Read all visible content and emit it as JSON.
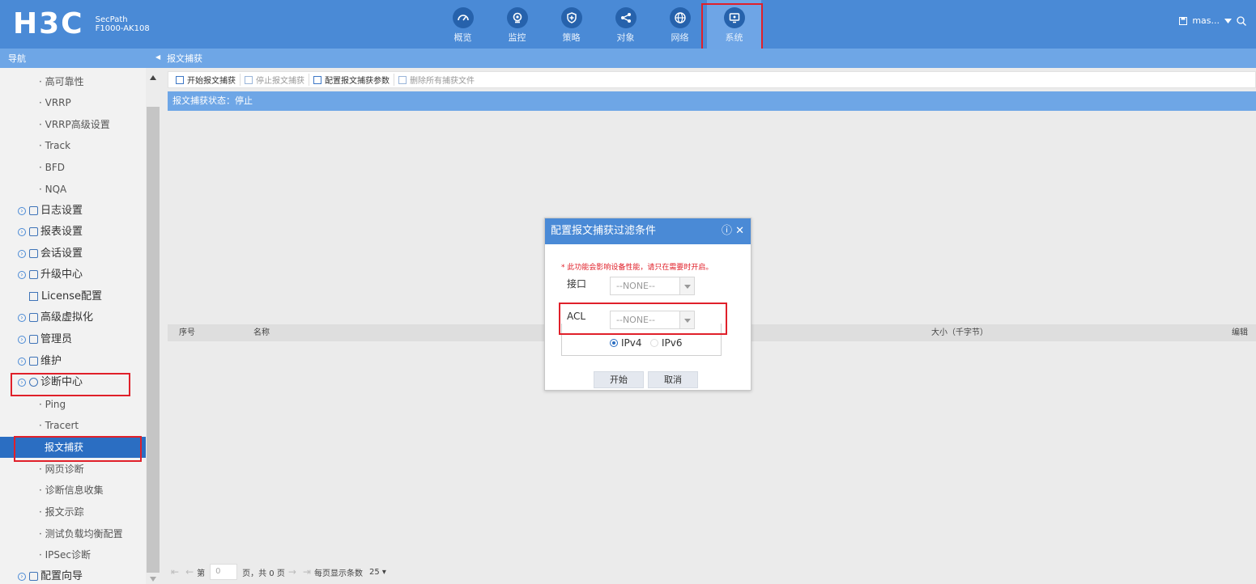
{
  "header": {
    "logo": "H3C",
    "product_line": "SecPath",
    "model": "F1000-AK108",
    "nav": [
      {
        "label": "概览",
        "icon": "dashboard-icon"
      },
      {
        "label": "监控",
        "icon": "camera-icon"
      },
      {
        "label": "策略",
        "icon": "shield-icon"
      },
      {
        "label": "对象",
        "icon": "share-icon"
      },
      {
        "label": "网络",
        "icon": "globe-icon"
      },
      {
        "label": "系统",
        "icon": "monitor-icon"
      }
    ],
    "user": "mas...",
    "accent_color": "#4a8ad6"
  },
  "subheader": {
    "nav_label": "导航",
    "breadcrumb": "报文捕获"
  },
  "sidebar": {
    "items": [
      {
        "label": "· 高可靠性",
        "type": "sub"
      },
      {
        "label": "· VRRP",
        "type": "sub"
      },
      {
        "label": "· VRRP高级设置",
        "type": "sub"
      },
      {
        "label": "· Track",
        "type": "sub"
      },
      {
        "label": "· BFD",
        "type": "sub"
      },
      {
        "label": "· NQA",
        "type": "sub"
      },
      {
        "label": "日志设置",
        "type": "group"
      },
      {
        "label": "报表设置",
        "type": "group"
      },
      {
        "label": "会话设置",
        "type": "group"
      },
      {
        "label": "升级中心",
        "type": "group"
      },
      {
        "label": "License配置",
        "type": "license"
      },
      {
        "label": "高级虚拟化",
        "type": "group"
      },
      {
        "label": "管理员",
        "type": "group"
      },
      {
        "label": "维护",
        "type": "group"
      },
      {
        "label": "诊断中心",
        "type": "group"
      },
      {
        "label": "· Ping",
        "type": "sub"
      },
      {
        "label": "· Tracert",
        "type": "sub"
      },
      {
        "label": "报文捕获",
        "type": "active"
      },
      {
        "label": "· 网页诊断",
        "type": "sub"
      },
      {
        "label": "· 诊断信息收集",
        "type": "sub"
      },
      {
        "label": "· 报文示踪",
        "type": "sub"
      },
      {
        "label": "· 测试负载均衡配置",
        "type": "sub"
      },
      {
        "label": "· IPSec诊断",
        "type": "sub"
      },
      {
        "label": "配置向导",
        "type": "group"
      }
    ]
  },
  "toolbar": {
    "start": "开始报文捕获",
    "stop": "停止报文捕获",
    "config": "配置报文捕获参数",
    "delete": "删除所有捕获文件"
  },
  "status": "报文捕获状态：停止",
  "table": {
    "columns": [
      "序号",
      "名称",
      "大小（千字节）",
      "编辑"
    ]
  },
  "pager": {
    "page_prefix": "第",
    "page_value": "0",
    "page_suffix": "页，共 0 页",
    "per_page_label": "每页显示条数",
    "per_page_value": "25"
  },
  "dialog": {
    "title": "配置报文捕获过滤条件",
    "warning": "* 此功能会影响设备性能，请只在需要时开启。",
    "interface_label": "接口",
    "interface_value": "--NONE--",
    "acl_label": "ACL",
    "acl_value": "--NONE--",
    "ipv4_label": "IPv4",
    "ipv6_label": "IPv6",
    "start_button": "开始",
    "cancel_button": "取消"
  }
}
